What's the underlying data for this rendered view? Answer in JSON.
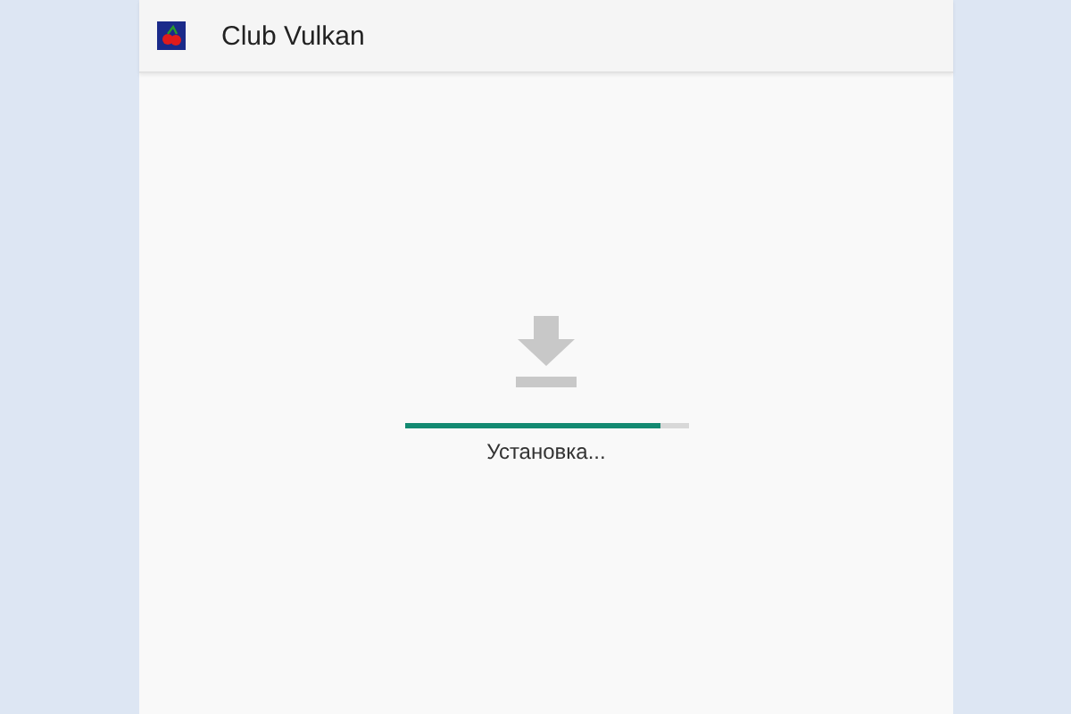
{
  "app_bar": {
    "title": "Club Vulkan"
  },
  "install": {
    "level": 0.9,
    "status": "Установка..."
  }
}
